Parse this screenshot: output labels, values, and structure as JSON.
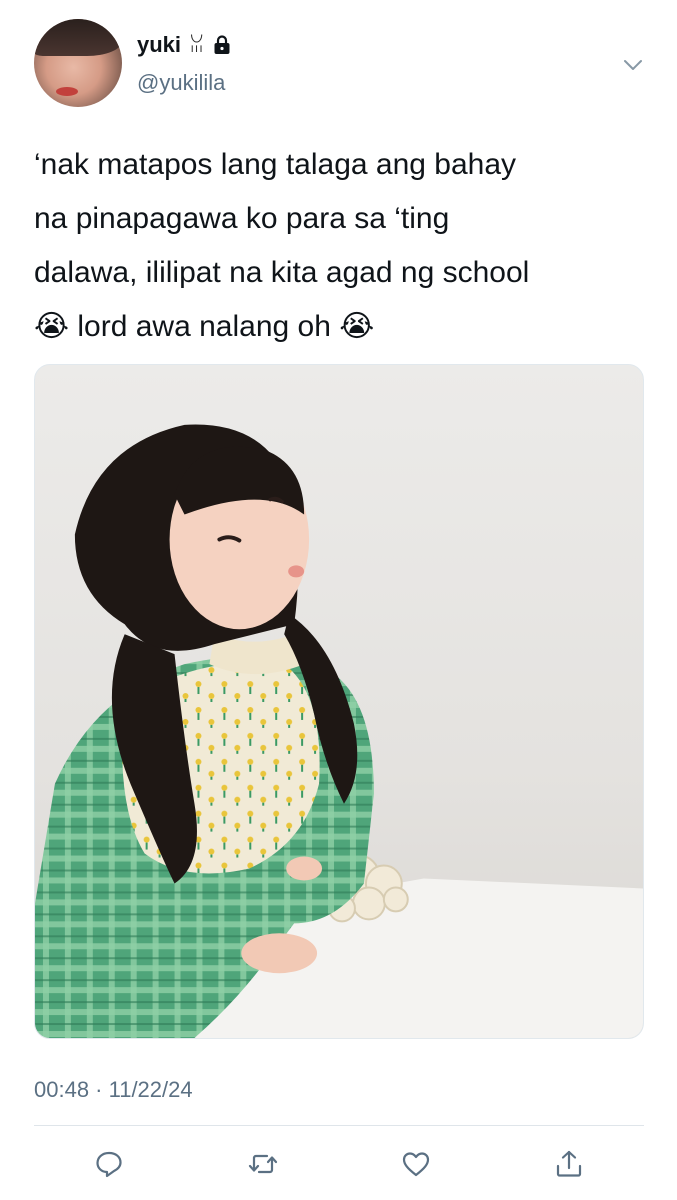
{
  "user": {
    "display_name": "yuki",
    "name_decoration": "ꈍ",
    "handle": "@yukilila",
    "protected_icon": "lock-icon"
  },
  "tweet": {
    "text": "‘nak matapos lang talaga ang bahay\nna pinapagawa ko para sa ‘ting\ndalawa, ililipat na kita agad ng school\n😭 lord awa nalang oh 😭",
    "timestamp": "00:48 · 11/22/24"
  },
  "icons": {
    "menu": "chevron-down-icon",
    "reply": "reply-icon",
    "retweet": "retweet-icon",
    "like": "heart-icon",
    "share": "share-icon"
  },
  "colors": {
    "secondary_text": "#5b7083",
    "primary_text": "#0f1419",
    "divider": "#dfe5ea"
  }
}
